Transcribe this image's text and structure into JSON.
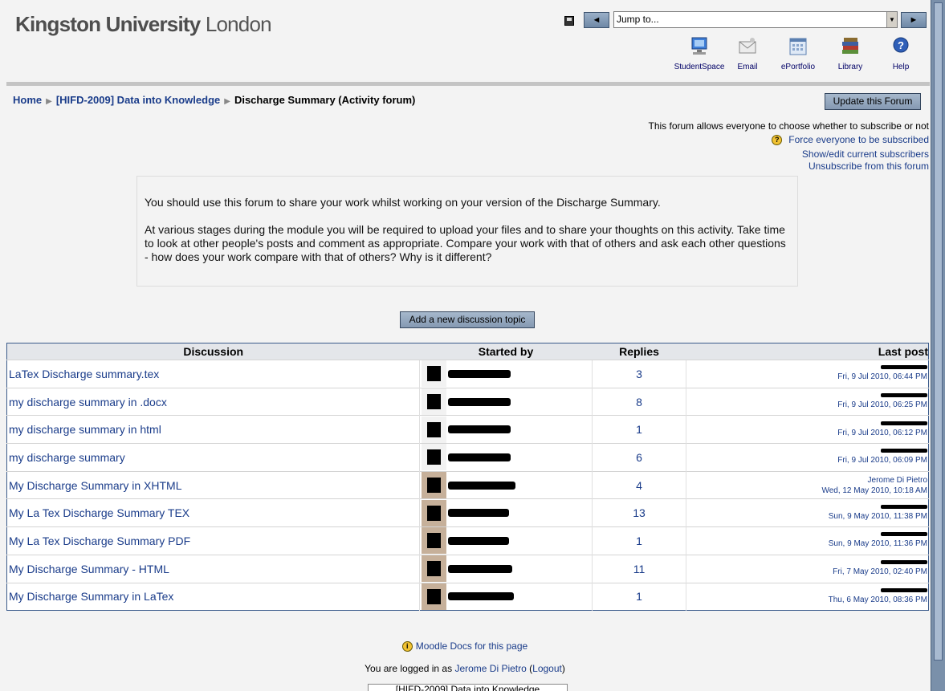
{
  "header": {
    "logo_bold": "Kingston University",
    "logo_light": " London",
    "jump_placeholder": "Jump to...",
    "prev_btn": "◄",
    "next_btn": "►",
    "links": [
      {
        "label": "StudentSpace",
        "icon": "computer-icon"
      },
      {
        "label": "Email",
        "icon": "envelope-icon"
      },
      {
        "label": "ePortfolio",
        "icon": "calendar-icon"
      },
      {
        "label": "Library",
        "icon": "books-icon"
      },
      {
        "label": "Help",
        "icon": "help-icon"
      }
    ]
  },
  "breadcrumb": {
    "home": "Home",
    "course": "[HIFD-2009] Data into Knowledge",
    "current": "Discharge Summary (Activity forum)"
  },
  "update_button": "Update this Forum",
  "subscription": {
    "info": "This forum allows everyone to choose whether to subscribe or not",
    "force": "Force everyone to be subscribed",
    "show": "Show/edit current subscribers",
    "unsubscribe": "Unsubscribe from this forum"
  },
  "intro": {
    "p1": "You should use this forum to share your work whilst working on your version of the Discharge Summary.",
    "p2": "At various stages during the module you will be required to upload your files and to share your thoughts on this activity. Take time to look at other people's posts and comment as appropriate. Compare your work with that of others and ask each other questions - how does your work compare with that of others? Why is it different?"
  },
  "add_button": "Add a new discussion topic",
  "table": {
    "headers": {
      "discussion": "Discussion",
      "started_by": "Started by",
      "replies": "Replies",
      "last_post": "Last post"
    },
    "rows": [
      {
        "topic": "LaTex Discharge summary.tex",
        "replies": "3",
        "last_name": "",
        "last_date": "Fri, 9 Jul 2010, 06:44 PM"
      },
      {
        "topic": "my discharge summary in .docx",
        "replies": "8",
        "last_name": "",
        "last_date": "Fri, 9 Jul 2010, 06:25 PM"
      },
      {
        "topic": "my discharge summary in html",
        "replies": "1",
        "last_name": "",
        "last_date": "Fri, 9 Jul 2010, 06:12 PM"
      },
      {
        "topic": "my discharge summary",
        "replies": "6",
        "last_name": "",
        "last_date": "Fri, 9 Jul 2010, 06:09 PM"
      },
      {
        "topic": "My Discharge Summary in XHTML",
        "replies": "4",
        "last_name": "Jerome Di Pietro",
        "last_date": "Wed, 12 May 2010, 10:18 AM"
      },
      {
        "topic": "My La Tex Discharge Summary TEX",
        "replies": "13",
        "last_name": "",
        "last_date": "Sun, 9 May 2010, 11:38 PM"
      },
      {
        "topic": "My La Tex Discharge Summary PDF",
        "replies": "1",
        "last_name": "",
        "last_date": "Sun, 9 May 2010, 11:36 PM"
      },
      {
        "topic": "My Discharge Summary - HTML",
        "replies": "11",
        "last_name": "",
        "last_date": "Fri, 7 May 2010, 02:40 PM"
      },
      {
        "topic": "My Discharge Summary in LaTex",
        "replies": "1",
        "last_name": "",
        "last_date": "Thu, 6 May 2010, 08:36 PM"
      }
    ]
  },
  "footer": {
    "docs": "Moodle Docs for this page",
    "logged_prefix": "You are logged in as ",
    "user": "Jerome Di Pietro",
    "logout": "Logout",
    "course_box": "[HIFD-2009] Data into Knowledge"
  }
}
